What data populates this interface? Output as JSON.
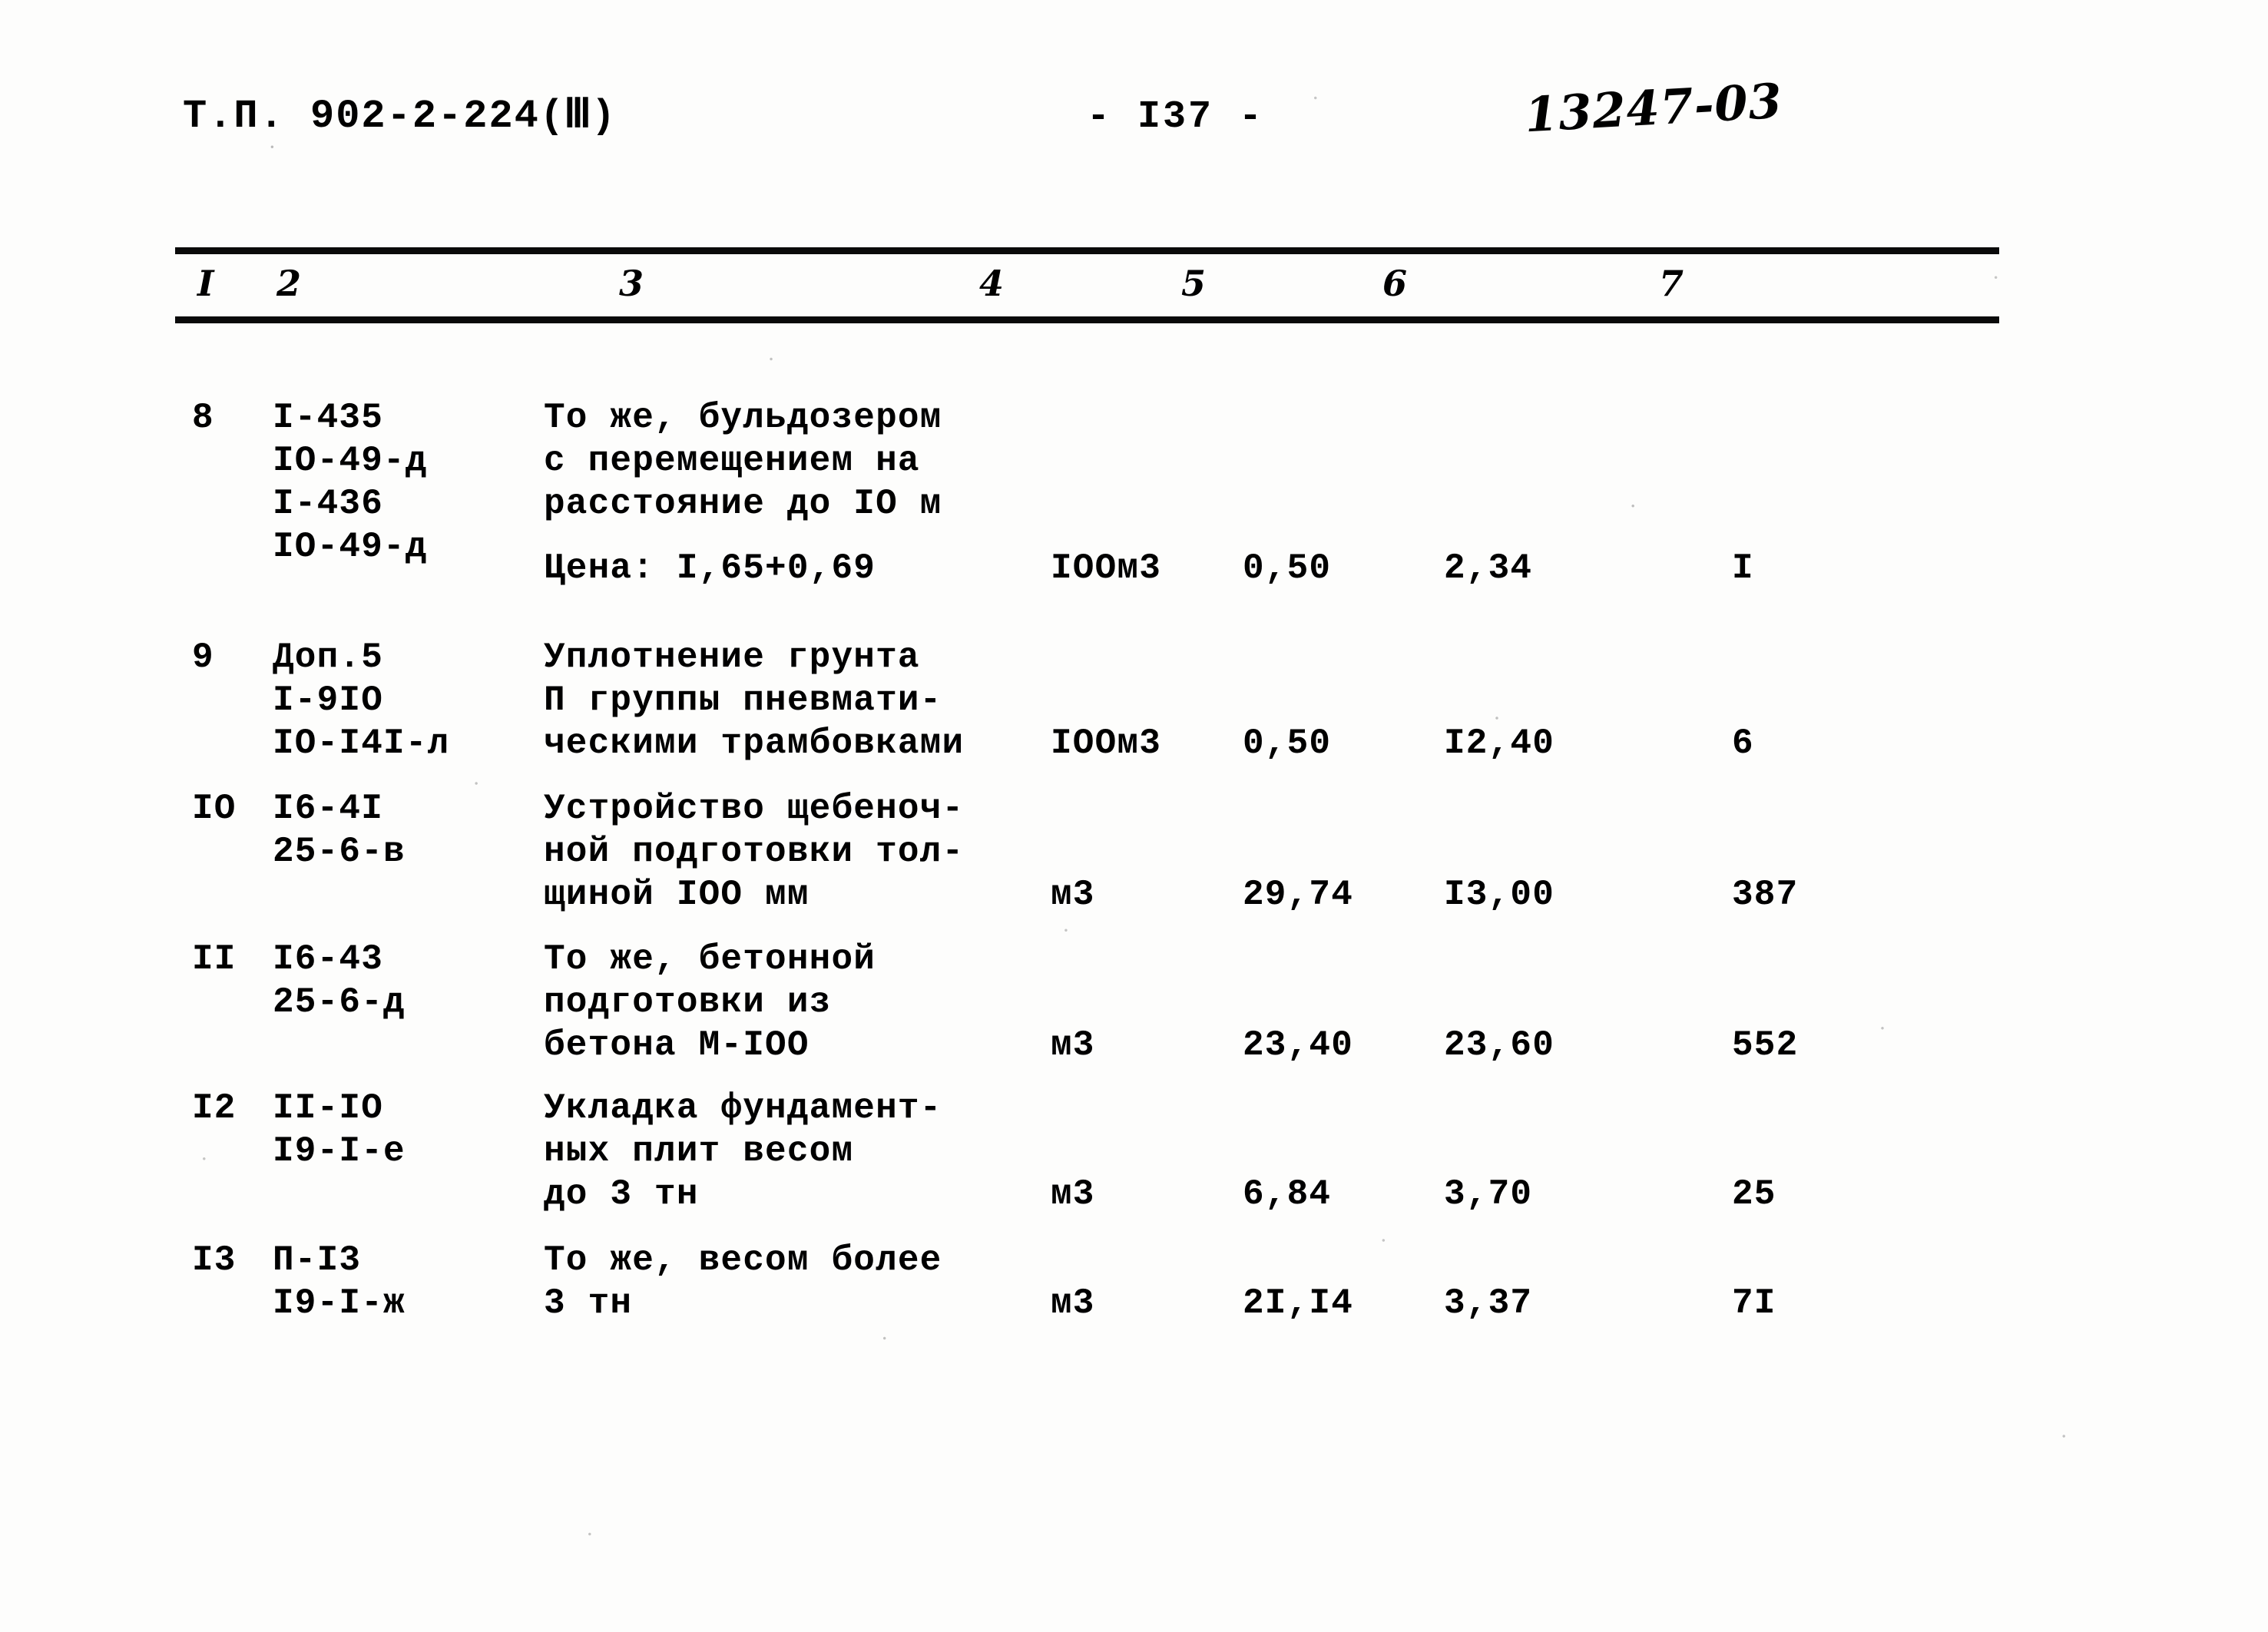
{
  "header": {
    "doc_code": "Т.П. 902-2-224",
    "volume": "(Ⅲ)",
    "page_number": "- I37 -",
    "archive_code": "13247-03"
  },
  "table": {
    "column_headers": [
      "I",
      "2",
      "3",
      "4",
      "5",
      "6",
      "7"
    ],
    "rows": [
      {
        "num": "8",
        "codes": "I-435\nIO-49-д\nI-436\nIO-49-д",
        "description": "То же, бульдозером\nс перемещением на\nрасстояние до IO м",
        "price_line": "Цена: I,65+0,69",
        "unit": "IOOм3",
        "v5": "0,50",
        "v6": "2,34",
        "v7": "I"
      },
      {
        "num": "9",
        "codes": "Доп.5\nI-9IO\nIO-I4I-л",
        "description": "Уплотнение грунта\nП группы пневмати-\nческими трамбовками",
        "price_line": "",
        "unit": "IOOм3",
        "v5": "0,50",
        "v6": "I2,40",
        "v7": "6"
      },
      {
        "num": "IO",
        "codes": "I6-4I\n25-6-в",
        "description": "Устройство щебеноч-\nной подготовки тол-\nщиной IOO мм",
        "price_line": "",
        "unit": "м3",
        "v5": "29,74",
        "v6": "I3,00",
        "v7": "387"
      },
      {
        "num": "II",
        "codes": "I6-43\n25-6-д",
        "description": "То же, бетонной\nподготовки из\nбетона М-IOO",
        "price_line": "",
        "unit": "м3",
        "v5": "23,40",
        "v6": "23,60",
        "v7": "552"
      },
      {
        "num": "I2",
        "codes": "II-IO\nI9-I-е",
        "description": "Укладка фундамент-\nных плит весом\nдо 3 тн",
        "price_line": "",
        "unit": "м3",
        "v5": "6,84",
        "v6": "3,70",
        "v7": "25"
      },
      {
        "num": "I3",
        "codes": "П-I3\nI9-I-ж",
        "description": "То же, весом более\n3 тн",
        "price_line": "",
        "unit": "м3",
        "v5": "2I,I4",
        "v6": "3,37",
        "v7": "7I"
      }
    ]
  }
}
